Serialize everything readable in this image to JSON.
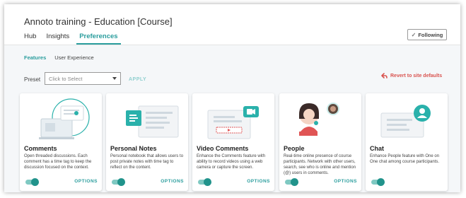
{
  "header": {
    "title": "Annoto training - Education [Course]",
    "tabs": [
      {
        "label": "Hub",
        "active": false
      },
      {
        "label": "Insights",
        "active": false
      },
      {
        "label": "Preferences",
        "active": true
      }
    ],
    "follow_button": {
      "label": "Following",
      "icon": "check-icon"
    }
  },
  "sub_tabs": [
    {
      "label": "Features",
      "active": true
    },
    {
      "label": "User Experience",
      "active": false
    }
  ],
  "preset": {
    "label": "Preset",
    "placeholder": "Click to Select",
    "apply_label": "APPLY"
  },
  "revert": {
    "label": "Revert to site defaults",
    "icon": "undo-arrow-icon"
  },
  "features": [
    {
      "title": "Comments",
      "description": "Open threaded discussions. Each comment has a time tag to keep the discussion focused on the context.",
      "enabled": true,
      "options_label": "OPTIONS",
      "icon": "comments-illustration"
    },
    {
      "title": "Personal Notes",
      "description": "Personal notebook that allows users to post private notes with time tag to reflect on the content.",
      "enabled": true,
      "options_label": "OPTIONS",
      "icon": "notes-illustration"
    },
    {
      "title": "Video Comments",
      "description": "Enhance the Comments feature with ability to record videos using a web camera or capture the screen.",
      "enabled": true,
      "options_label": "OPTIONS",
      "icon": "video-comments-illustration"
    },
    {
      "title": "People",
      "description": "Real-time online presence of course participants. Network with other users, search, see who is online and mention (@) users in comments.",
      "enabled": true,
      "options_label": "OPTIONS",
      "icon": "people-illustration"
    },
    {
      "title": "Chat",
      "description": "Enhance People feature with One on One chat among course participants.",
      "enabled": true,
      "options_label": "",
      "icon": "chat-illustration"
    }
  ],
  "colors": {
    "accent": "#2a9d9d",
    "toggle_knob": "#21938b",
    "revert": "#d9534f"
  }
}
